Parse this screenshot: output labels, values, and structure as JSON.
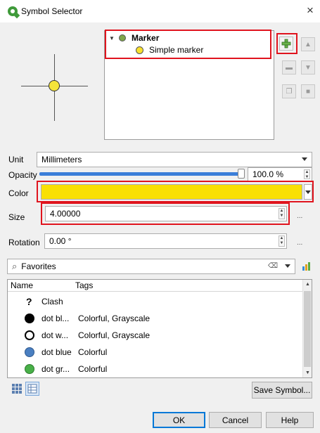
{
  "window": {
    "title": "Symbol Selector",
    "close_glyph": "×"
  },
  "tree": {
    "items": [
      {
        "label": "Marker",
        "color": "#7fa64b"
      },
      {
        "label": "Simple marker",
        "color": "#f9e02c"
      }
    ]
  },
  "form": {
    "unit_label": "Unit",
    "unit_value": "Millimeters",
    "opacity_label": "Opacity",
    "opacity_value": "100.0 %",
    "opacity_level": 1.0,
    "color_label": "Color",
    "color_value": "#f9e003",
    "size_label": "Size",
    "size_value": "4.00000",
    "rotation_label": "Rotation",
    "rotation_value": "0.00 °",
    "data_defined_glyph": "..."
  },
  "search": {
    "value": "Favorites",
    "clear_glyph": "⌫"
  },
  "list": {
    "columns": [
      "Name",
      "Tags"
    ],
    "rows": [
      {
        "name": "Clash",
        "tags": "",
        "icon": "question-mark-icon",
        "glyph": "?"
      },
      {
        "name": "dot bl...",
        "tags": "Colorful, Grayscale",
        "icon": "dot-black-icon",
        "fill": "#000000"
      },
      {
        "name": "dot w...",
        "tags": "Colorful, Grayscale",
        "icon": "dot-white-icon",
        "fill": "#ffffff"
      },
      {
        "name": "dot blue",
        "tags": "Colorful",
        "icon": "dot-blue-icon",
        "fill": "#4a7fc1"
      },
      {
        "name": "dot gr...",
        "tags": "Colorful",
        "icon": "dot-green-icon",
        "fill": "#48b048"
      }
    ]
  },
  "buttons": {
    "save_symbol": "Save Symbol...",
    "ok": "OK",
    "cancel": "Cancel",
    "help": "Help"
  },
  "colors": {
    "highlight": "#e0141e",
    "accent": "#0078d7",
    "slider": "#3a7ed9"
  }
}
